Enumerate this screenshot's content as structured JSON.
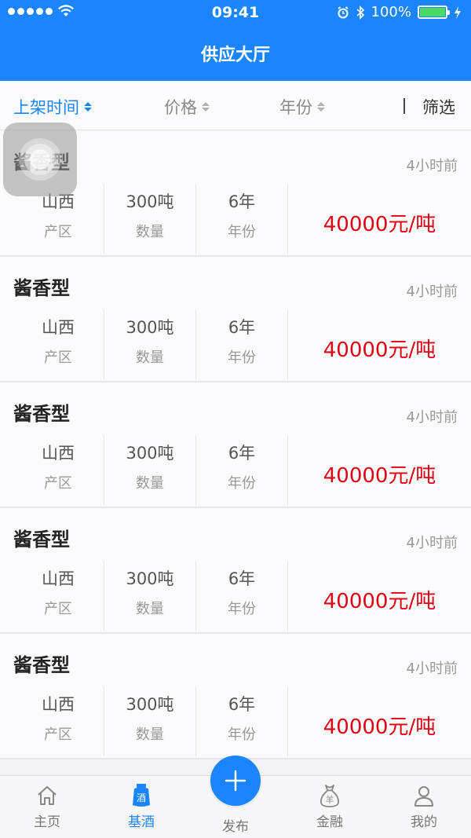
{
  "status_bar": {
    "time": "09:41",
    "battery": "100%",
    "battery_level": 1.0
  },
  "nav": {
    "title": "供应大厅"
  },
  "filters": {
    "items": [
      {
        "label": "上架时间",
        "active": true
      },
      {
        "label": "价格",
        "active": false
      },
      {
        "label": "年份",
        "active": false
      }
    ],
    "filter_button": "筛选"
  },
  "listings": [
    {
      "type": "酱香型",
      "posted": "4小时前",
      "origin": "山西",
      "origin_label": "产区",
      "quantity": "300吨",
      "quantity_label": "数量",
      "years": "6年",
      "years_label": "年份",
      "price": "40000元/吨"
    },
    {
      "type": "酱香型",
      "posted": "4小时前",
      "origin": "山西",
      "origin_label": "产区",
      "quantity": "300吨",
      "quantity_label": "数量",
      "years": "6年",
      "years_label": "年份",
      "price": "40000元/吨"
    },
    {
      "type": "酱香型",
      "posted": "4小时前",
      "origin": "山西",
      "origin_label": "产区",
      "quantity": "300吨",
      "quantity_label": "数量",
      "years": "6年",
      "years_label": "年份",
      "price": "40000元/吨"
    },
    {
      "type": "酱香型",
      "posted": "4小时前",
      "origin": "山西",
      "origin_label": "产区",
      "quantity": "300吨",
      "quantity_label": "数量",
      "years": "6年",
      "years_label": "年份",
      "price": "40000元/吨"
    },
    {
      "type": "酱香型",
      "posted": "4小时前",
      "origin": "山西",
      "origin_label": "产区",
      "quantity": "300吨",
      "quantity_label": "数量",
      "years": "6年",
      "years_label": "年份",
      "price": "40000元/吨"
    }
  ],
  "tabbar": {
    "home": "主页",
    "base_liquor": "基酒",
    "base_liquor_icon_text": "酒",
    "publish": "发布",
    "finance": "金融",
    "finance_icon_text": "羊",
    "mine": "我的"
  },
  "colors": {
    "primary": "#1a85ff",
    "price": "#e00012"
  }
}
